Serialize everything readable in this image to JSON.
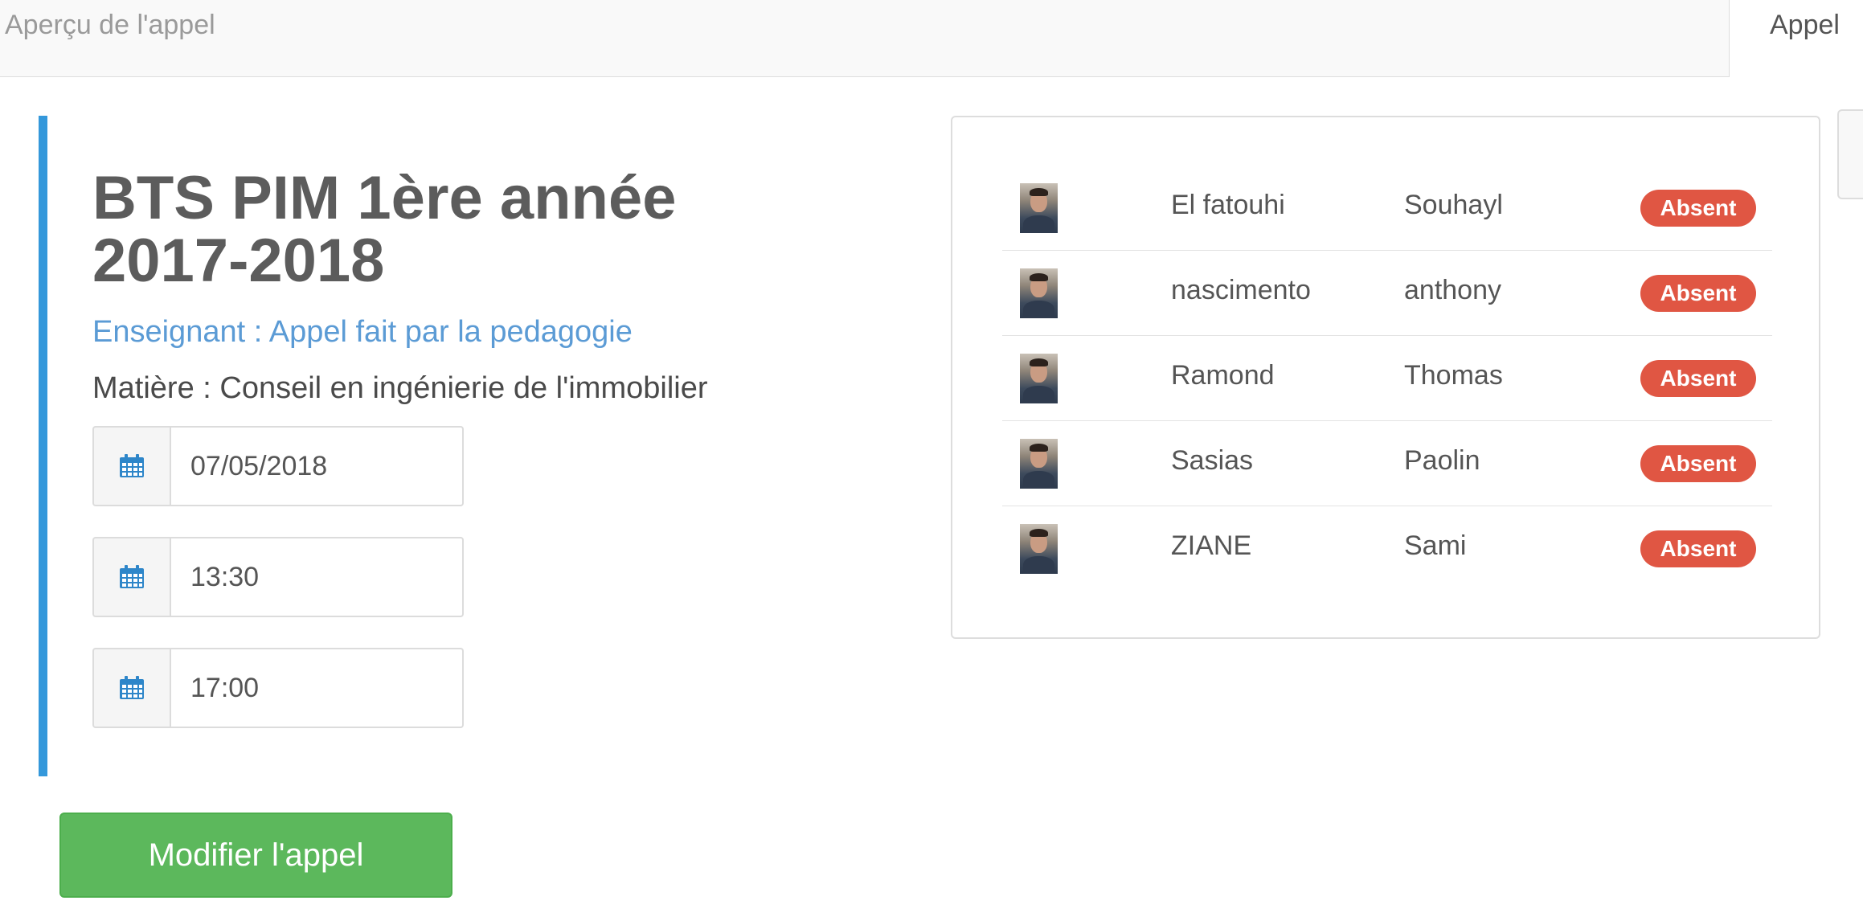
{
  "header": {
    "title": "Aperçu de l'appel",
    "tab_label": "Appel"
  },
  "session": {
    "class_title": "BTS PIM 1ère année 2017-2018",
    "teacher": "Enseignant : Appel fait par la pedagogie",
    "subject": "Matière : Conseil en ingénierie de l'immobilier",
    "date": "07/05/2018",
    "start_time": "13:30",
    "end_time": "17:00"
  },
  "actions": {
    "edit_label": "Modifier l'appel"
  },
  "students": [
    {
      "last_name": "El fatouhi",
      "first_name": "Souhayl",
      "status": "Absent"
    },
    {
      "last_name": "nascimento",
      "first_name": "anthony",
      "status": "Absent"
    },
    {
      "last_name": "Ramond",
      "first_name": "Thomas",
      "status": "Absent"
    },
    {
      "last_name": "Sasias",
      "first_name": "Paolin",
      "status": "Absent"
    },
    {
      "last_name": "ZIANE",
      "first_name": "Sami",
      "status": "Absent"
    }
  ],
  "colors": {
    "accent_bar": "#3498db",
    "teacher_text": "#5b9bd5",
    "button_green": "#5cb85c",
    "absent_badge": "#e05643"
  },
  "icons": {
    "field_icon": "calendar-icon"
  }
}
